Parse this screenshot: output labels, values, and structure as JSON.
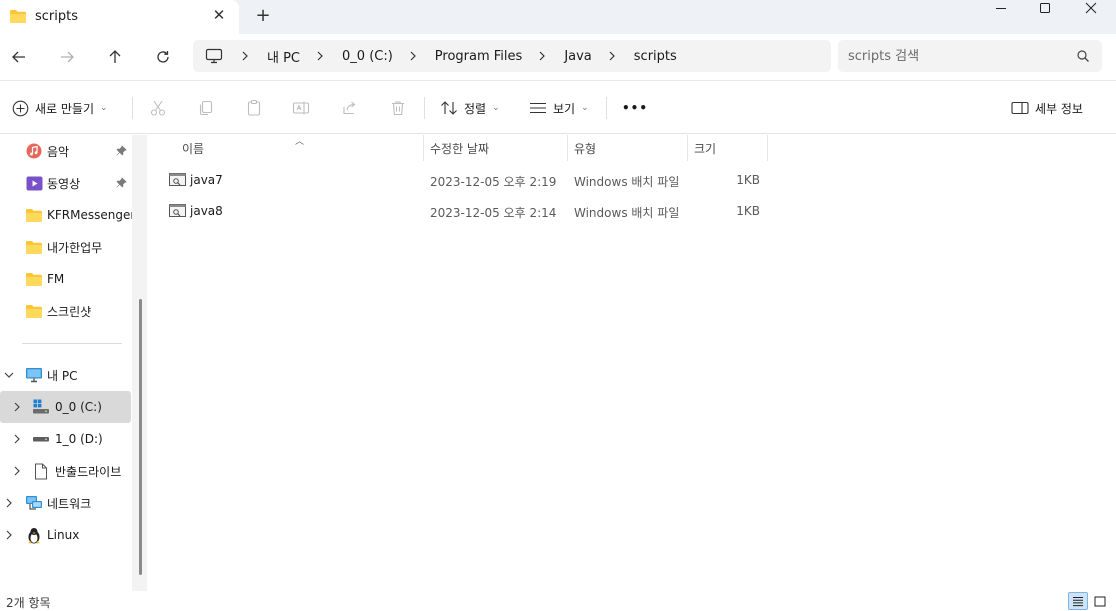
{
  "tab": {
    "title": "scripts",
    "close": "✕",
    "new_tab": "+"
  },
  "window": {
    "minimize": "minimize",
    "maximize": "maximize",
    "close": "close"
  },
  "address": {
    "crumbs": [
      "내 PC",
      "0_0 (C:)",
      "Program Files",
      "Java",
      "scripts"
    ]
  },
  "search": {
    "placeholder": "scripts 검색"
  },
  "commands": {
    "new_label": "새로 만들기",
    "sort_label": "정렬",
    "view_label": "보기",
    "more_label": "•••",
    "details_label": "세부 정보"
  },
  "sidebar": {
    "quick": [
      {
        "label": "음악",
        "icon": "music-icon",
        "pinned": true
      },
      {
        "label": "동영상",
        "icon": "video-icon",
        "pinned": true
      },
      {
        "label": "KFRMessenger",
        "icon": "folder-icon",
        "pinned": false
      },
      {
        "label": "내가한업무",
        "icon": "folder-icon",
        "pinned": false
      },
      {
        "label": "FM",
        "icon": "folder-icon",
        "pinned": false
      },
      {
        "label": "스크린샷",
        "icon": "folder-icon",
        "pinned": false
      }
    ],
    "this_pc": "내 PC",
    "drives": [
      {
        "label": "0_0 (C:)",
        "icon": "system-drive-icon",
        "selected": true
      },
      {
        "label": "1_0 (D:)",
        "icon": "drive-icon",
        "selected": false
      },
      {
        "label": "반출드라이브",
        "icon": "document-icon",
        "selected": false
      }
    ],
    "network": "네트워크",
    "linux": "Linux"
  },
  "columns": {
    "name": "이름",
    "modified": "수정한 날짜",
    "type": "유형",
    "size": "크기"
  },
  "files": [
    {
      "name": "java7",
      "modified": "2023-12-05 오후 2:19",
      "type": "Windows 배치 파일",
      "size": "1KB"
    },
    {
      "name": "java8",
      "modified": "2023-12-05 오후 2:14",
      "type": "Windows 배치 파일",
      "size": "1KB"
    }
  ],
  "status": {
    "count": "2개 항목"
  },
  "colors": {
    "accent": "#0067c0",
    "folder": "#f8c636",
    "selected": "#d9d9d9"
  }
}
